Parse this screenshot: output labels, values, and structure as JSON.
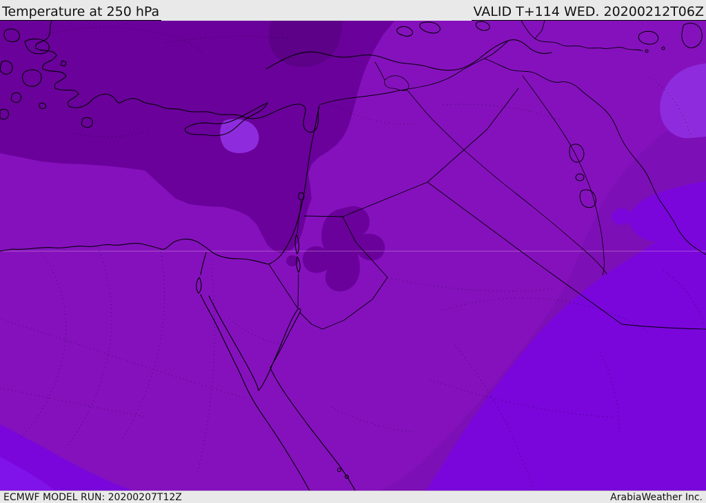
{
  "header": {
    "title": "Temperature at 250 hPa",
    "validity": "VALID T+114 WED. 20200212T06Z"
  },
  "footer": {
    "model_run": "ECMWF MODEL RUN: 20200207T12Z",
    "credit": "ArabiaWeather Inc."
  },
  "map": {
    "description": "250 hPa temperature shading over the Middle East and Eastern Mediterranean",
    "bar_background": "#e9e9e9",
    "text_color": "#111111",
    "coast_color": "#000000",
    "border_color": "#000000",
    "river_color": "#000000",
    "gridline_color": "#dfa9df",
    "levels": [
      {
        "name": "band-coldest",
        "color": "#5c0188"
      },
      {
        "name": "band-dark",
        "color": "#6a019b"
      },
      {
        "name": "band-base",
        "color": "#8511bd"
      },
      {
        "name": "band-muted",
        "color": "#7d0fb6"
      },
      {
        "name": "band-light",
        "color": "#8e2cdd"
      },
      {
        "name": "band-bright",
        "color": "#7a06db"
      },
      {
        "name": "band-brightest",
        "color": "#8013ea"
      }
    ]
  }
}
